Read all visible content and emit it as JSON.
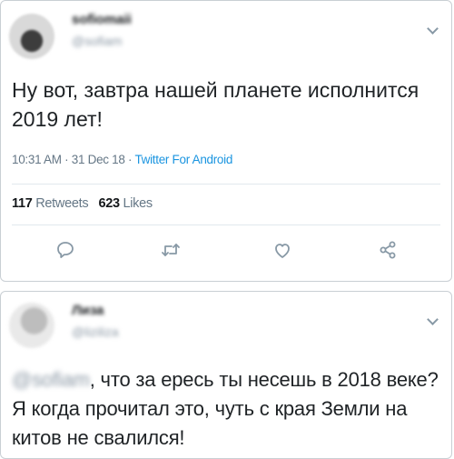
{
  "tweet1": {
    "author_name": "sofiomaii",
    "author_handle": "@sofiam",
    "text": "Ну вот, завтра нашей планете исполнится 2019 лет!",
    "time": "10:31 AM",
    "date": "31 Dec 18",
    "source": "Twitter For Android",
    "retweets_count": "117",
    "retweets_label": "Retweets",
    "likes_count": "623",
    "likes_label": "Likes",
    "icons": [
      "reply-icon",
      "retweet-icon",
      "like-icon",
      "share-icon",
      "chevron-down-icon"
    ]
  },
  "tweet2": {
    "author_name": "Лиза",
    "author_handle": "@liziliza",
    "mention": "@sofiam",
    "text": ", что за ересь ты несешь в 2018 веке? Я когда прочитал это, чуть с края Земли на китов не свалился!",
    "icons": [
      "chevron-down-icon"
    ]
  },
  "colors": {
    "link": "#1b95e0",
    "muted": "#657786",
    "icon": "#8899a6",
    "border": "#c9cfd4"
  }
}
